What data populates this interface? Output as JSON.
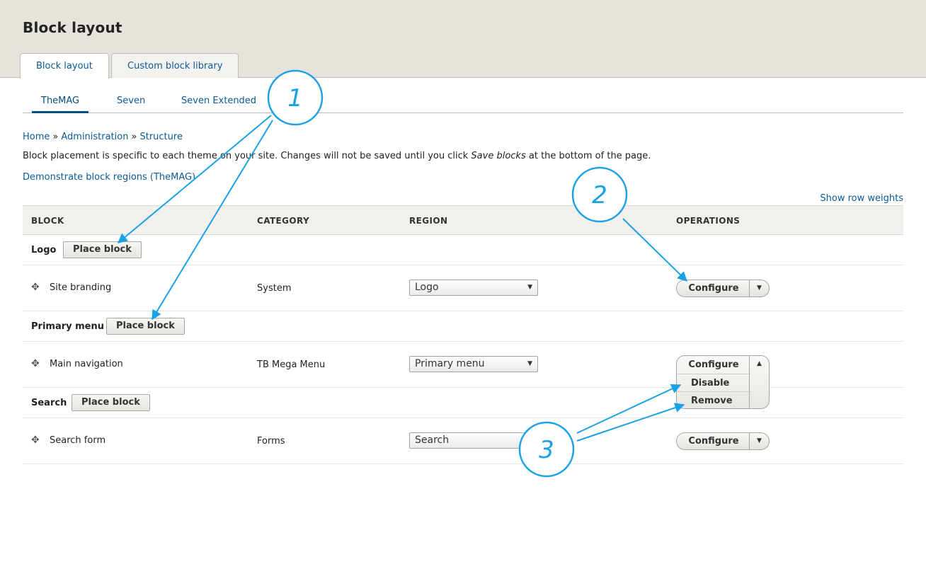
{
  "page": {
    "title": "Block layout"
  },
  "primary_tabs": [
    {
      "label": "Block layout",
      "active": true
    },
    {
      "label": "Custom block library",
      "active": false
    }
  ],
  "theme_tabs": [
    {
      "label": "TheMAG",
      "active": true
    },
    {
      "label": "Seven",
      "active": false
    },
    {
      "label": "Seven Extended",
      "active": false
    }
  ],
  "breadcrumb": {
    "items": [
      "Home",
      "Administration",
      "Structure"
    ],
    "separator": "»"
  },
  "help": {
    "text_before": "Block placement is specific to each theme on your site. Changes will not be saved until you click ",
    "emphasis": "Save blocks",
    "text_after": " at the bottom of the page."
  },
  "demo_link": "Demonstrate block regions (TheMAG)",
  "row_weights_link": "Show row weights",
  "table": {
    "headers": {
      "block": "BLOCK",
      "category": "CATEGORY",
      "region": "REGION",
      "operations": "OPERATIONS"
    },
    "place_block_label": "Place block",
    "regions": [
      {
        "title": "Logo",
        "block": {
          "name": "Site branding",
          "category": "System",
          "region": "Logo",
          "operation": "Configure"
        }
      },
      {
        "title": "Primary menu",
        "block": {
          "name": "Main navigation",
          "category": "TB Mega Menu",
          "region": "Primary menu",
          "operations_open": [
            "Configure",
            "Disable",
            "Remove"
          ]
        }
      },
      {
        "title": "Search",
        "block": {
          "name": "Search form",
          "category": "Forms",
          "region": "Search",
          "operation": "Configure"
        }
      }
    ]
  },
  "icons": {
    "drag": "move-handle-icon",
    "dropdown_down": "caret-down-icon",
    "dropdown_up": "caret-up-icon",
    "select_arrow": "select-arrow-icon"
  },
  "annotations": {
    "labels": [
      "1",
      "2",
      "3"
    ],
    "color": "#1aa2e6"
  }
}
